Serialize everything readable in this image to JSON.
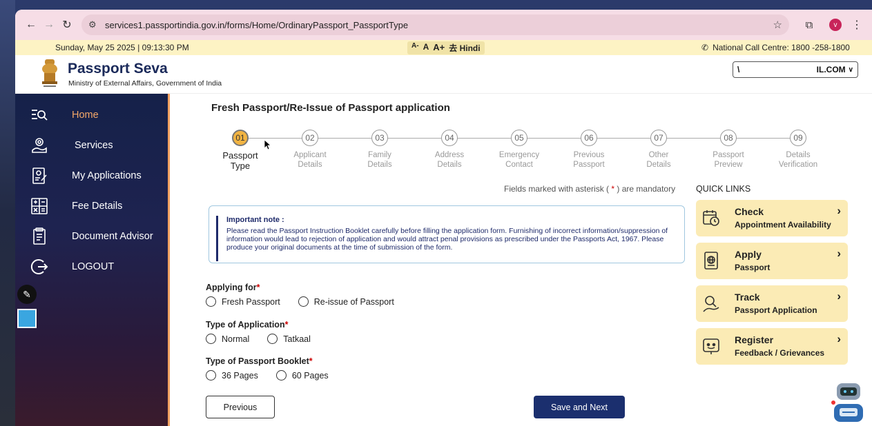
{
  "browser": {
    "url": "services1.passportindia.gov.in/forms/Home/OrdinaryPassport_PassportType",
    "profile_initial": "v"
  },
  "info_strip": {
    "date_time": "Sunday, May 25 2025 | 09:13:30 PM",
    "font_small": "A-",
    "font_normal": "A",
    "font_large": "A+",
    "language": "Hindi",
    "call_centre": "National Call Centre: 1800 -258-1800"
  },
  "header": {
    "title": "Passport Seva",
    "subtitle": "Ministry of External Affairs, Government of India",
    "user_left": "\\",
    "user_right": "IL.COM"
  },
  "sidebar": {
    "items": [
      {
        "label": "Home",
        "icon": "home-icon"
      },
      {
        "label": "Services",
        "icon": "services-icon"
      },
      {
        "label": "My Applications",
        "icon": "applications-icon"
      },
      {
        "label": "Fee Details",
        "icon": "fee-icon"
      },
      {
        "label": "Document Advisor",
        "icon": "document-icon"
      },
      {
        "label": "LOGOUT",
        "icon": "logout-icon"
      }
    ]
  },
  "main": {
    "heading": "Fresh Passport/Re-Issue of Passport application",
    "steps": [
      {
        "num": "01",
        "line1": "Passport",
        "line2": "Type"
      },
      {
        "num": "02",
        "line1": "Applicant",
        "line2": "Details"
      },
      {
        "num": "03",
        "line1": "Family",
        "line2": "Details"
      },
      {
        "num": "04",
        "line1": "Address",
        "line2": "Details"
      },
      {
        "num": "05",
        "line1": "Emergency",
        "line2": "Contact"
      },
      {
        "num": "06",
        "line1": "Previous",
        "line2": "Passport"
      },
      {
        "num": "07",
        "line1": "Other",
        "line2": "Details"
      },
      {
        "num": "08",
        "line1": "Passport",
        "line2": "Preview"
      },
      {
        "num": "09",
        "line1": "Details",
        "line2": "Verification"
      }
    ],
    "mandatory_pre": "Fields marked with asterisk (",
    "mandatory_ast": " * ",
    "mandatory_post": ") are mandatory",
    "note_title": "Important note :",
    "note_text": "Please read the Passport Instruction Booklet carefully before filling the application form. Furnishing of incorrect information/suppression of information would lead to rejection of application and would attract penal provisions as prescribed under the Passports Act, 1967. Please produce your original documents at the time of submission of the form.",
    "applying_for": {
      "label": "Applying for",
      "opt1": "Fresh Passport",
      "opt2": "Re-issue of Passport"
    },
    "type_of_application": {
      "label": "Type of Application",
      "opt1": "Normal",
      "opt2": "Tatkaal"
    },
    "booklet": {
      "label": "Type of Passport Booklet",
      "opt1": "36 Pages",
      "opt2": "60 Pages"
    },
    "previous_label": "Previous",
    "next_label": "Save and Next"
  },
  "quick_links": {
    "title": "QUICK LINKS",
    "items": [
      {
        "main": "Check",
        "sub": "Appointment Availability"
      },
      {
        "main": "Apply",
        "sub": "Passport"
      },
      {
        "main": "Track",
        "sub": "Passport Application"
      },
      {
        "main": "Register",
        "sub": "Feedback / Grievances"
      }
    ]
  },
  "colors": {
    "sidebar_bg": "#152149",
    "accent_orange": "#f5a868",
    "quick_card_bg": "#fbebb5",
    "primary_button": "#1b2f6e"
  }
}
